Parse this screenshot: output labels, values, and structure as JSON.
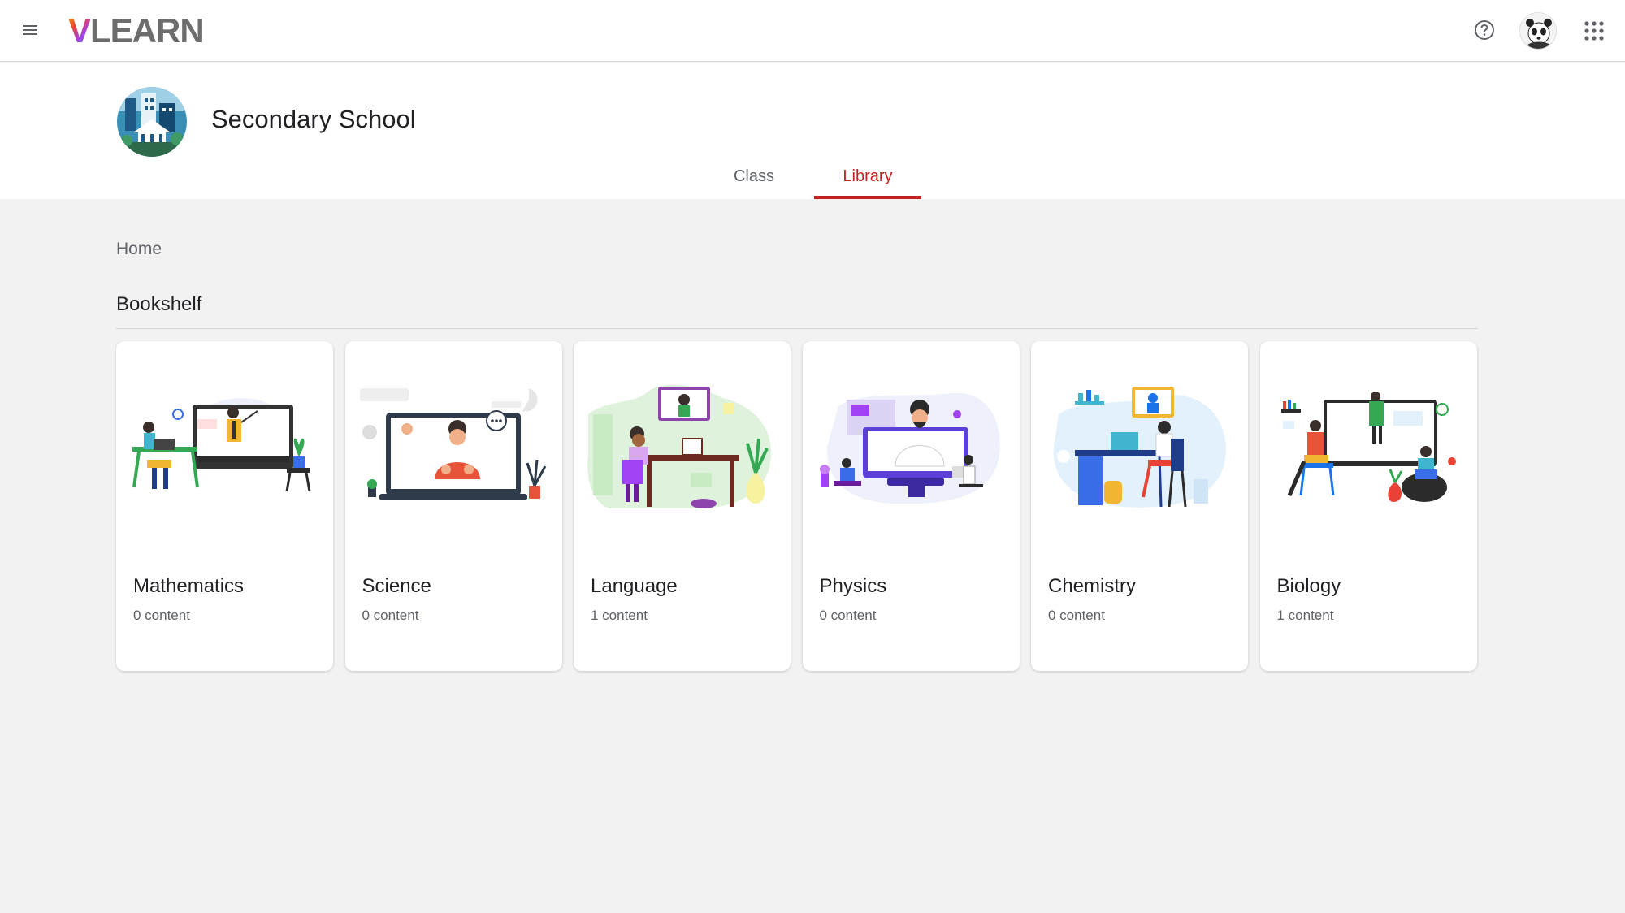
{
  "app": {
    "logo_v": "V",
    "logo_rest": "LEARN"
  },
  "header": {
    "class_name": "Secondary School",
    "tabs": [
      {
        "label": "Class",
        "active": false
      },
      {
        "label": "Library",
        "active": true
      }
    ]
  },
  "breadcrumb": "Home",
  "section_title": "Bookshelf",
  "subjects": [
    {
      "name": "Mathematics",
      "count": "0 content",
      "icon": "online-teacher-illustration"
    },
    {
      "name": "Science",
      "count": "0 content",
      "icon": "video-call-illustration"
    },
    {
      "name": "Language",
      "count": "1 content",
      "icon": "student-desk-illustration"
    },
    {
      "name": "Physics",
      "count": "0 content",
      "icon": "online-class-illustration"
    },
    {
      "name": "Chemistry",
      "count": "0 content",
      "icon": "study-desk-illustration"
    },
    {
      "name": "Biology",
      "count": "1 content",
      "icon": "virtual-classroom-illustration"
    }
  ],
  "colors": {
    "accent": "#c5221f",
    "background": "#f2f2f2"
  }
}
